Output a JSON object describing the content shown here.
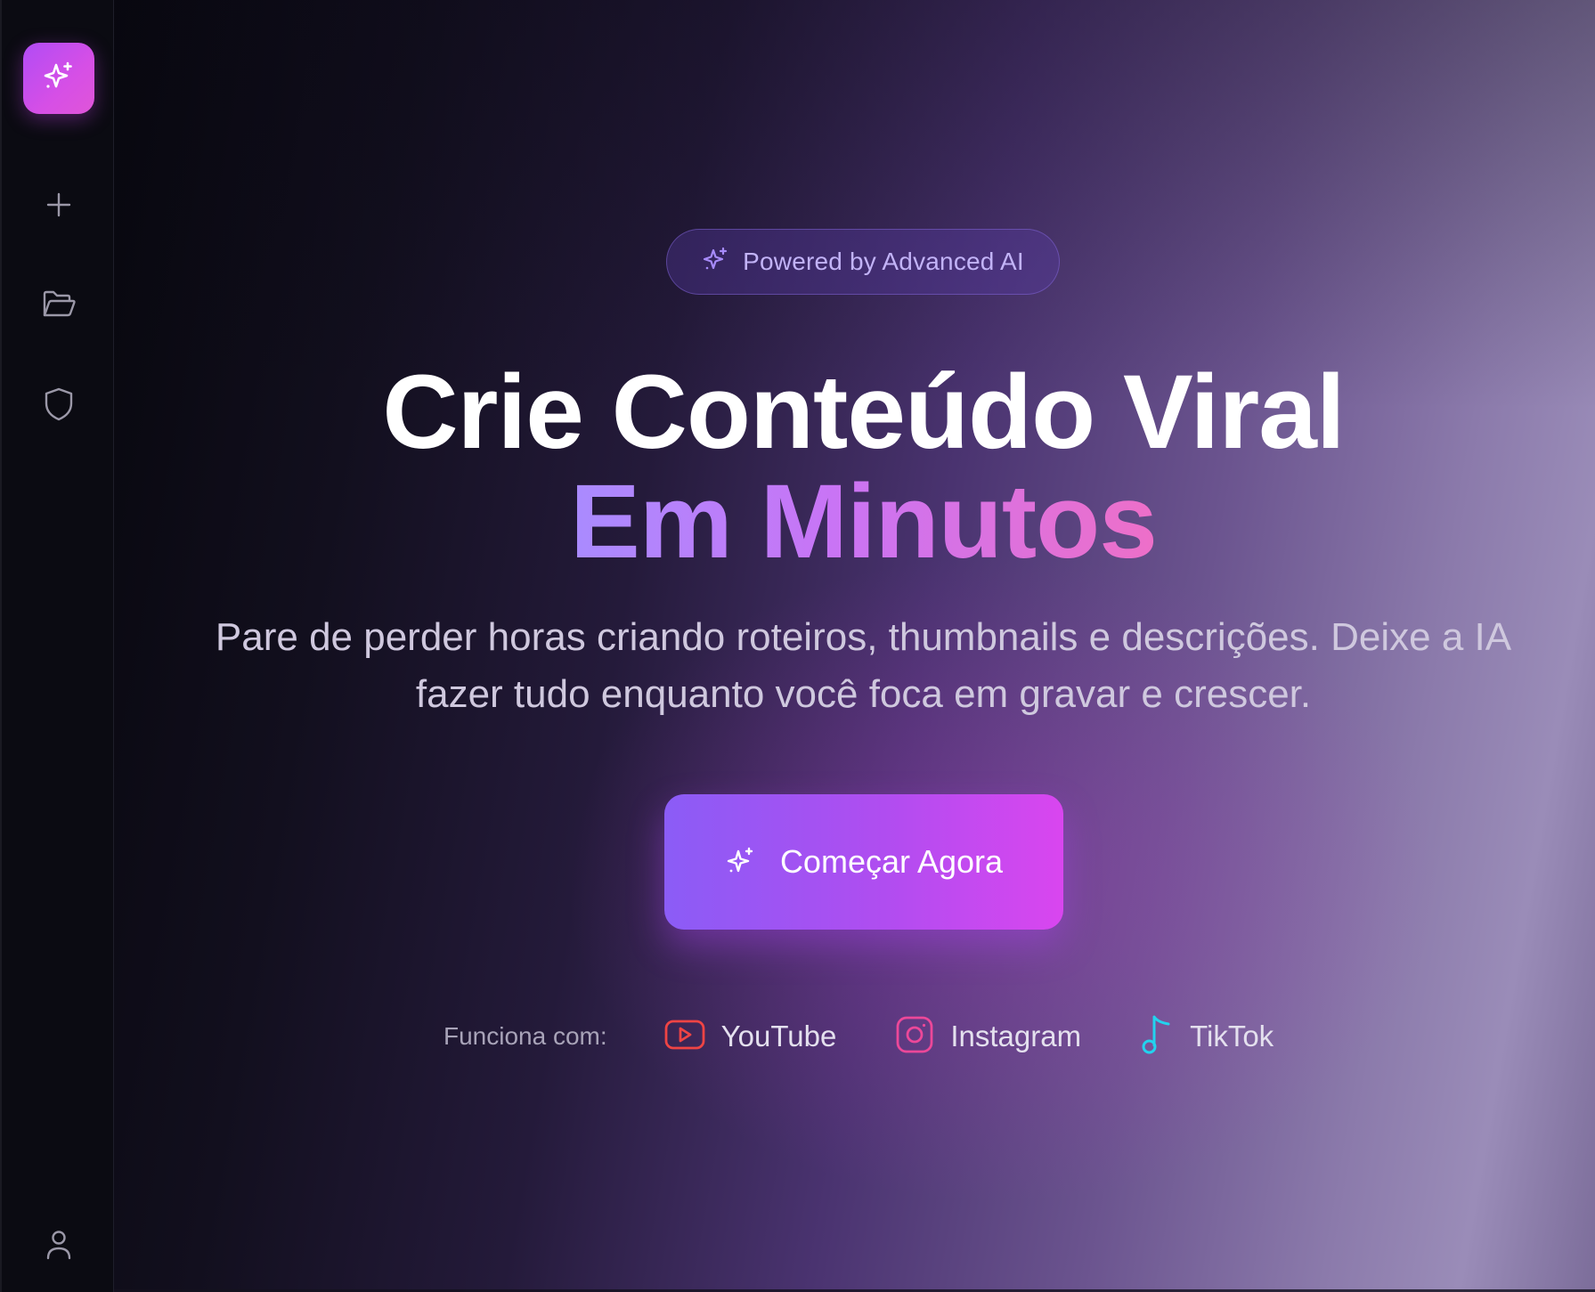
{
  "sidebar": {
    "logo_icon": "sparkles-icon",
    "items": [
      {
        "icon": "plus-icon"
      },
      {
        "icon": "folder-open-icon"
      },
      {
        "icon": "shield-icon"
      }
    ],
    "footer_icon": "user-icon"
  },
  "hero": {
    "badge_text": "Powered by Advanced AI",
    "headline_line1": "Crie Conteúdo Viral",
    "headline_line2": "Em Minutos",
    "subtitle": "Pare de perder horas criando roteiros, thumbnails e descrições. Deixe a IA fazer tudo enquanto você foca em gravar e crescer.",
    "cta_label": "Começar Agora",
    "works_with_label": "Funciona com:",
    "platforms": [
      {
        "label": "YouTube",
        "icon": "youtube-icon",
        "color": "#ef4444"
      },
      {
        "label": "Instagram",
        "icon": "instagram-icon",
        "color": "#ec4899"
      },
      {
        "label": "TikTok",
        "icon": "tiktok-icon",
        "color": "#22d3ee"
      }
    ]
  },
  "colors": {
    "accent_purple": "#8b5cf6",
    "accent_magenta": "#d946ef",
    "badge_text": "#c2b3f7"
  }
}
